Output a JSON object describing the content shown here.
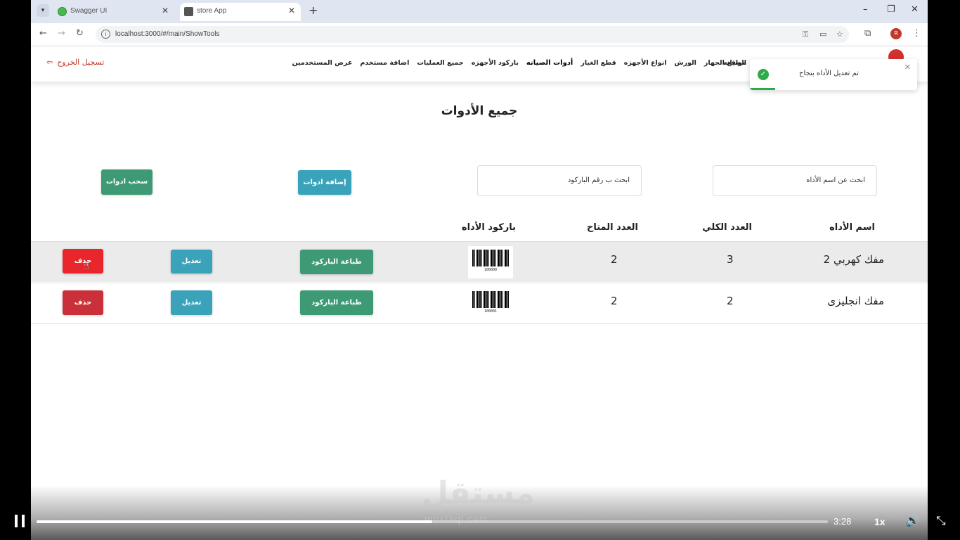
{
  "browser": {
    "tabs": [
      {
        "title": "Swagger UI",
        "active": false
      },
      {
        "title": "store App",
        "active": true
      }
    ],
    "url": "localhost:3000/#/main/ShowTools",
    "profile_initial": "R"
  },
  "navbar": {
    "logout_label": "تسجيل الخروج",
    "links": [
      "مواقع الجهاز",
      "الورش",
      "انواع الأجهزه",
      "قطع الغيار",
      "أدوات الصيانه",
      "باركود الأجهزه",
      "جميع العمليات",
      "اضافة مستخدم",
      "عرض المستخدمين"
    ],
    "active_link": "أدوات الصيانه",
    "partial_first_link": "الصيانه"
  },
  "toast": {
    "message": "تم تعديل الأداه بنجاح",
    "status_color": "#2eaa4a",
    "progress": 0.15
  },
  "page": {
    "title": "جميع الأدوات",
    "search_name_placeholder": "ابحث عن اسم الأداه",
    "search_barcode_placeholder": "ابحث ب رقم الباركود",
    "add_tools_label": "إضافة ادوات",
    "withdraw_tools_label": "سحب ادوات"
  },
  "table": {
    "headers": {
      "name": "اسم الأداه",
      "total": "العدد الكلي",
      "available": "العدد المتاح",
      "barcode": "باركود الأداه"
    },
    "rows": [
      {
        "name": "مفك كهربي 2",
        "total": "3",
        "available": "2",
        "barcode_number": "100000",
        "print_label": "طباعة الباركود",
        "edit_label": "تعديل",
        "delete_label": "حذف"
      },
      {
        "name": "مفك انجليزى",
        "total": "2",
        "available": "2",
        "barcode_number": "100001",
        "print_label": "طباعة الباركود",
        "edit_label": "تعديل",
        "delete_label": "حذف"
      }
    ]
  },
  "player": {
    "time": "3:28",
    "speed": "1x",
    "progress": 0.5,
    "watermark": "مستقل",
    "watermark_sub": "mostaql.com"
  },
  "colors": {
    "teal": "#3aa3ba",
    "green": "#3d9a75",
    "red": "#e8262c",
    "dark_red": "#c9303a"
  }
}
